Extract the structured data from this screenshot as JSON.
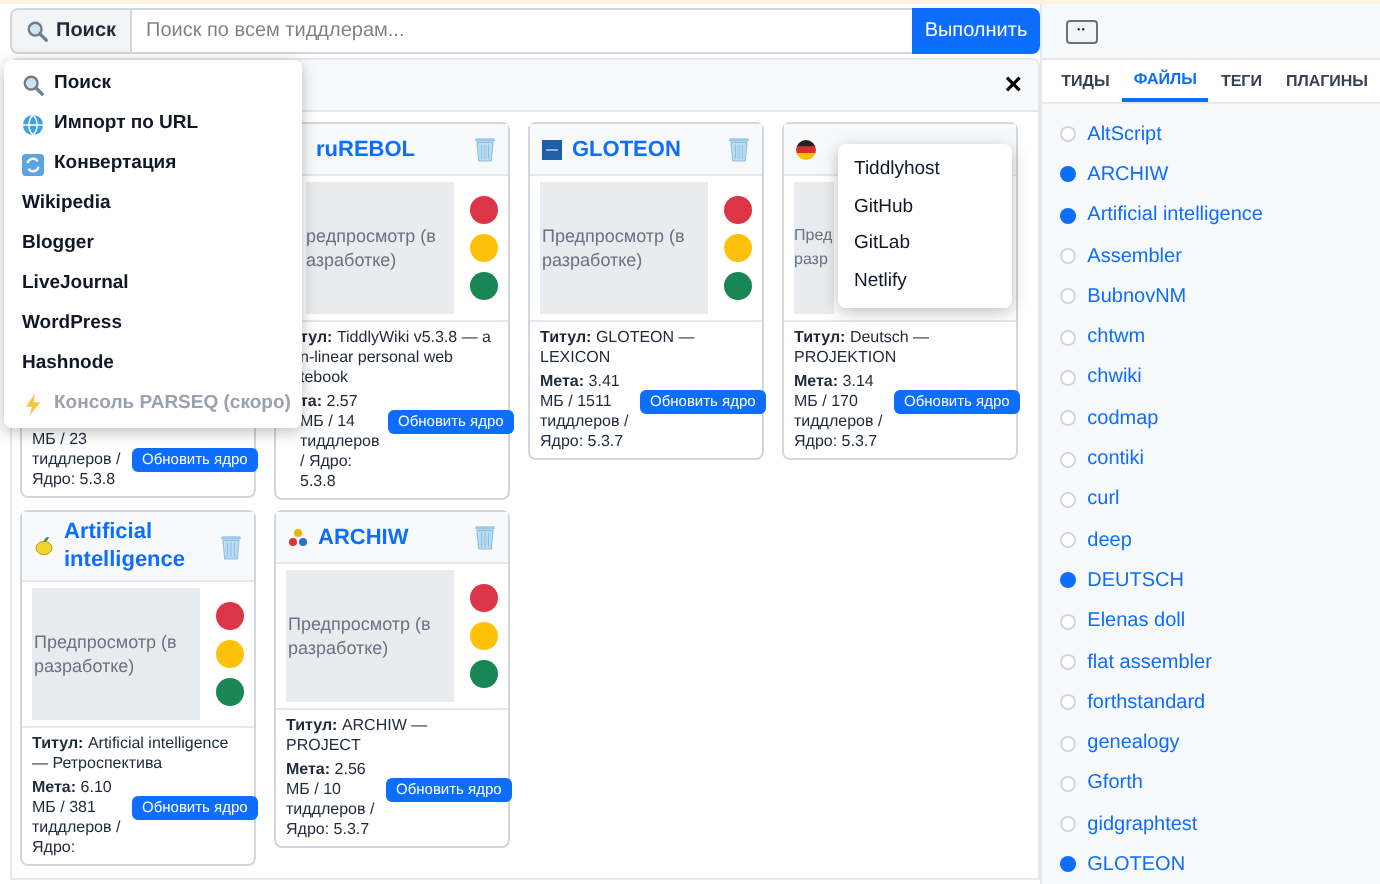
{
  "search": {
    "label": "Поиск",
    "placeholder": "Поиск по всем тиддлерам...",
    "button": "Выполнить"
  },
  "search_menu": [
    {
      "kind": "search",
      "label": "Поиск",
      "disabled": false
    },
    {
      "kind": "globe",
      "label": "Импорт по URL",
      "disabled": false
    },
    {
      "kind": "convert",
      "label": "Конвертация",
      "disabled": false
    },
    {
      "kind": "plain",
      "label": "Wikipedia",
      "disabled": false
    },
    {
      "kind": "plain",
      "label": "Blogger",
      "disabled": false
    },
    {
      "kind": "plain",
      "label": "LiveJournal",
      "disabled": false
    },
    {
      "kind": "plain",
      "label": "WordPress",
      "disabled": false
    },
    {
      "kind": "plain",
      "label": "Hashnode",
      "disabled": false
    },
    {
      "kind": "bolt",
      "label": "Консоль PARSEQ (скоро)",
      "disabled": true
    }
  ],
  "panel": {
    "close": "×"
  },
  "cards": [
    {
      "kind": "covered",
      "meta": "МБ / 23 тиддлеров / Ядро: 5.3.8",
      "button": "Обновить ядро"
    },
    {
      "kind": "cut_left",
      "title": "ruREBOL",
      "preview": "редпросмотр (в азработке)",
      "title_line": "**тул:** TiddlyWiki v5.3.8 — a n-linear personal web tebook",
      "meta": "**та:** 2.57 МБ / 14 тиддлеров / Ядро: 5.3.8",
      "button": "Обновить ядро"
    },
    {
      "kind": "square",
      "title": "GLOTEON",
      "preview": "Предпросмотр (в разработке)",
      "title_line": "**Титул:** GLOTEON — LEXICON",
      "meta": "**Мета:** 3.41 МБ / 1511 тиддлеров / Ядро: 5.3.7",
      "button": "Обновить ядро"
    },
    {
      "kind": "flag",
      "preview": "Пред разр",
      "title_line": "**Титул:** Deutsch — PROJEKTION",
      "meta": "**Мета:** 3.14 МБ / 170 тиддлеров / Ядро: 5.3.7",
      "button": "Обновить ядро"
    },
    {
      "kind": "lemon",
      "title": "Artificial intelligence",
      "preview": "Предпросмотр (в разработке)",
      "title_line": "**Титул:** Artificial intelligence — Ретроспектива",
      "meta": "**Мета:** 6.10 МБ / 381 тиддлеров / Ядро:",
      "button": "Обновить ядро"
    },
    {
      "kind": "dots",
      "title": "ARCHIW",
      "preview": "Предпросмотр (в разработке)",
      "title_line": "**Титул:** ARCHIW — PROJECT",
      "meta": "**Мета:** 2.56 МБ / 10 тиддлеров / Ядро: 5.3.7",
      "button": "Обновить ядро"
    }
  ],
  "publish_menu": [
    "Tiddlyhost",
    "GitHub",
    "GitLab",
    "Netlify"
  ],
  "sidebar": {
    "toggle": "··",
    "tabs": [
      {
        "label": "ТИДЫ",
        "selected": false
      },
      {
        "label": "ФАЙЛЫ",
        "selected": true
      },
      {
        "label": "ТЕГИ",
        "selected": false
      },
      {
        "label": "ПЛАГИНЫ",
        "selected": false
      }
    ],
    "items": [
      {
        "label": "AltScript",
        "selected": false
      },
      {
        "label": "ARCHIW",
        "selected": true
      },
      {
        "label": "Artificial intelligence",
        "selected": true
      },
      {
        "label": "Assembler",
        "selected": false
      },
      {
        "label": "BubnovNM",
        "selected": false
      },
      {
        "label": "chtwm",
        "selected": false
      },
      {
        "label": "chwiki",
        "selected": false
      },
      {
        "label": "codmap",
        "selected": false
      },
      {
        "label": "contiki",
        "selected": false
      },
      {
        "label": "curl",
        "selected": false
      },
      {
        "label": "deep",
        "selected": false
      },
      {
        "label": "DEUTSCH",
        "selected": true
      },
      {
        "label": "Elenas doll",
        "selected": false
      },
      {
        "label": "flat assembler",
        "selected": false
      },
      {
        "label": "forthstandard",
        "selected": false
      },
      {
        "label": "genealogy",
        "selected": false
      },
      {
        "label": "Gforth",
        "selected": false
      },
      {
        "label": "gidgraphtest",
        "selected": false
      },
      {
        "label": "GLOTEON",
        "selected": true
      }
    ]
  }
}
